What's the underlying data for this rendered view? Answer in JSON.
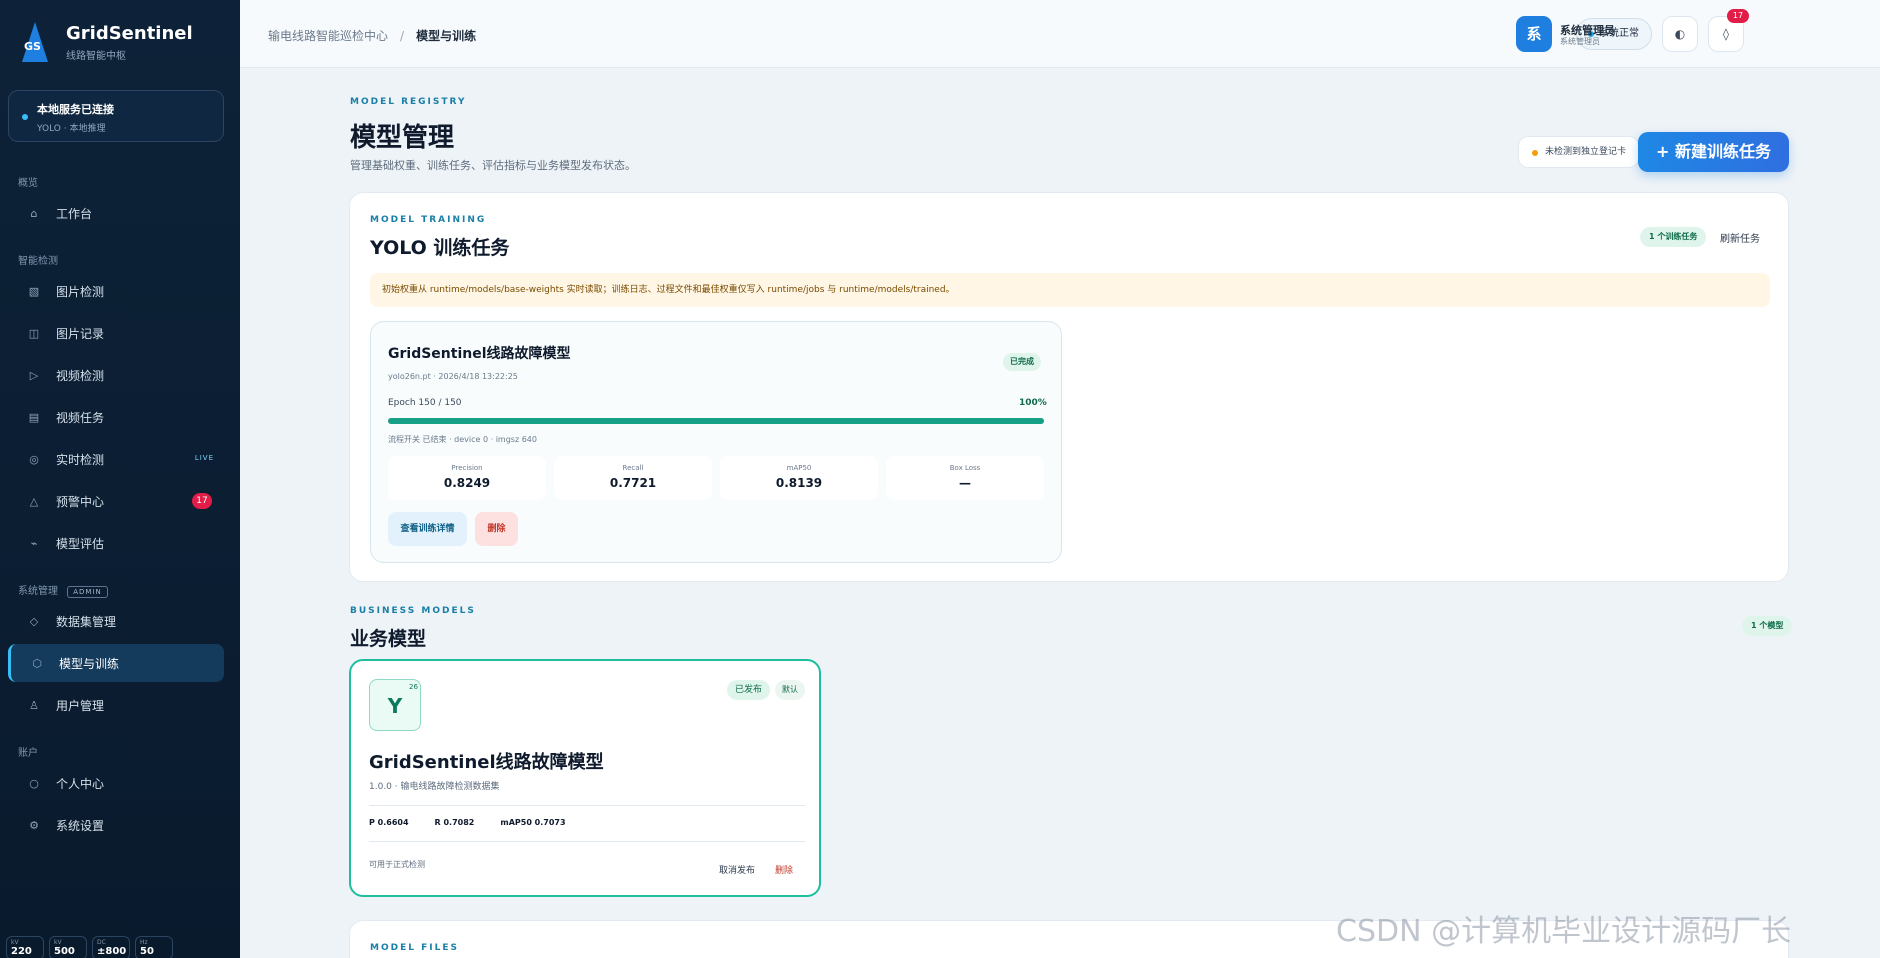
{
  "brand": {
    "name": "GridSentinel",
    "subtitle": "线路智能中枢",
    "logo_text": "GS"
  },
  "service": {
    "title": "本地服务已连接",
    "subtitle": "YOLO · 本地推理"
  },
  "sidebar": {
    "sections": {
      "overview": "概览",
      "detection": "智能检测",
      "system": "系统管理",
      "system_tag": "ADMIN",
      "account": "账户"
    },
    "items": [
      {
        "label": "工作台",
        "icon": "home-icon"
      },
      {
        "label": "图片检测",
        "icon": "image-icon"
      },
      {
        "label": "图片记录",
        "icon": "record-icon"
      },
      {
        "label": "视频检测",
        "icon": "play-icon"
      },
      {
        "label": "视频任务",
        "icon": "list-icon"
      },
      {
        "label": "实时检测",
        "icon": "target-icon",
        "tag": "LIVE"
      },
      {
        "label": "预警中心",
        "icon": "alert-icon",
        "badge": "17"
      },
      {
        "label": "模型评估",
        "icon": "trend-icon"
      },
      {
        "label": "数据集管理",
        "icon": "diamond-icon"
      },
      {
        "label": "模型与训练",
        "icon": "hexagon-icon",
        "active": true
      },
      {
        "label": "用户管理",
        "icon": "user-icon"
      },
      {
        "label": "个人中心",
        "icon": "circle-icon"
      },
      {
        "label": "系统设置",
        "icon": "gear-icon"
      }
    ],
    "stats": [
      {
        "k": "kV",
        "v": "220"
      },
      {
        "k": "kV",
        "v": "500"
      },
      {
        "k": "DC",
        "v": "±800"
      },
      {
        "k": "Hz",
        "v": "50"
      }
    ]
  },
  "topbar": {
    "breadcrumb_root": "输电线路智能巡检中心",
    "breadcrumb_sep": "/",
    "breadcrumb_current": "模型与训练",
    "status": "系统正常",
    "theme_icon": "◐",
    "bell_icon": "◊",
    "notif_count": "17",
    "avatar_text": "系",
    "user_name": "系统管理员",
    "user_role": "系统管理员",
    "caret": "⌄"
  },
  "page": {
    "eyebrow": "MODEL REGISTRY",
    "title": "模型管理",
    "subtitle": "管理基础权重、训练任务、评估指标与业务模型发布状态。",
    "registry_status": "未检测到独立登记卡",
    "new_button": "+ 新建训练任务"
  },
  "training": {
    "eyebrow": "MODEL TRAINING",
    "title": "YOLO 训练任务",
    "count": "1 个训练任务",
    "refresh": "刷新任务",
    "notice": "初始权重从 runtime/models/base-weights 实时读取；训练日志、过程文件和最佳权重仅写入 runtime/jobs 与 runtime/models/trained。",
    "job": {
      "name": "GridSentinel线路故障模型",
      "meta": "yolo26n.pt · 2026/4/18 13:22:25",
      "status": "已完成",
      "epoch_label": "Epoch 150 / 150",
      "progress_text": "100%",
      "progress": 1.0,
      "device": "流程开关 已结束 · device 0 · imgsz 640",
      "metrics": [
        {
          "k": "Precision",
          "v": "0.8249"
        },
        {
          "k": "Recall",
          "v": "0.7721"
        },
        {
          "k": "mAP50",
          "v": "0.8139"
        },
        {
          "k": "Box Loss",
          "v": "—"
        }
      ],
      "detail_btn": "查看训练详情",
      "delete_btn": "删除"
    }
  },
  "business": {
    "eyebrow": "BUSINESS MODELS",
    "title": "业务模型",
    "count": "1 个模型",
    "model": {
      "badge": "Y",
      "badge_sup": "26",
      "published": "已发布",
      "default": "默认",
      "name": "GridSentinel线路故障模型",
      "meta": "1.0.0 · 输电线路故障检测数据集",
      "metric_p": "P 0.6604",
      "metric_r": "R 0.7082",
      "metric_map": "mAP50 0.7073",
      "foot": "可用于正式检测",
      "unpublish": "取消发布",
      "delete": "删除"
    }
  },
  "files": {
    "eyebrow": "MODEL FILES"
  },
  "watermark": "CSDN @计算机毕业设计源码厂长"
}
